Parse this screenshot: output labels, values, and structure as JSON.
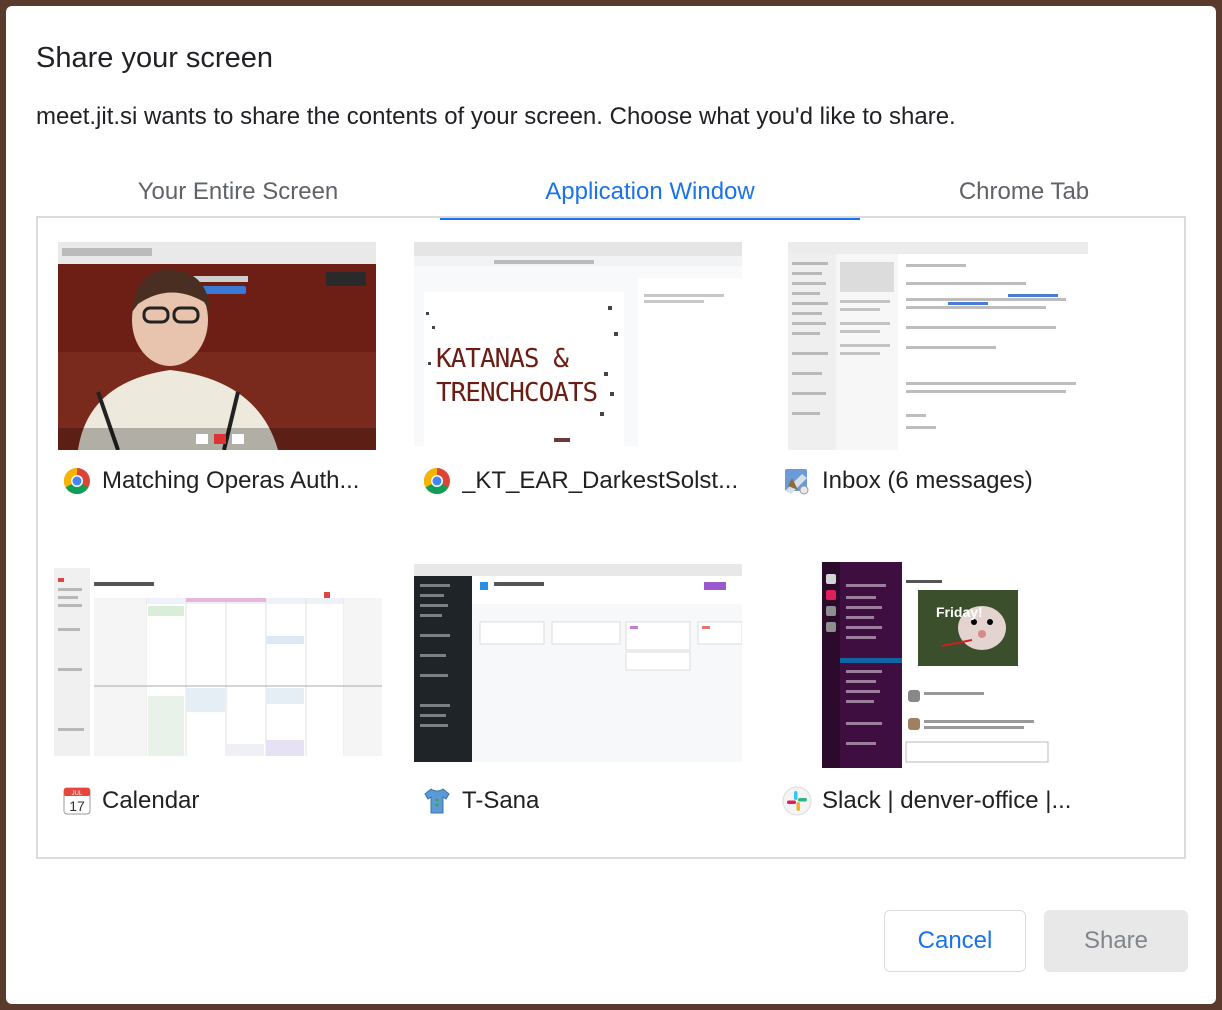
{
  "dialog": {
    "title": "Share your screen",
    "subtitle": "meet.jit.si wants to share the contents of your screen. Choose what you'd like to share."
  },
  "tabs": [
    {
      "label": "Your Entire Screen",
      "selected": false
    },
    {
      "label": "Application Window",
      "selected": true
    },
    {
      "label": "Chrome Tab",
      "selected": false
    }
  ],
  "windows": [
    {
      "label": "Matching Operas Auth...",
      "icon": "chrome-icon"
    },
    {
      "label": "_KT_EAR_DarkestSolst...",
      "icon": "chrome-icon"
    },
    {
      "label": "Inbox (6 messages)",
      "icon": "mail-icon"
    },
    {
      "label": "Calendar",
      "icon": "calendar-icon",
      "calendar_day": "17",
      "calendar_month": "JUL"
    },
    {
      "label": "T-Sana",
      "icon": "tshirt-icon"
    },
    {
      "label": "Slack | denver-office |...",
      "icon": "slack-icon"
    }
  ],
  "thumbnail_text": {
    "doc_title_line1": "KATANAS &",
    "doc_title_line2": "TRENCHCOATS",
    "slack_gif_text": "Friday!"
  },
  "buttons": {
    "cancel": "Cancel",
    "share": "Share"
  },
  "colors": {
    "accent": "#1a73e8",
    "slack_sidebar": "#3f0e40",
    "video_bg": "#6b1d14"
  }
}
